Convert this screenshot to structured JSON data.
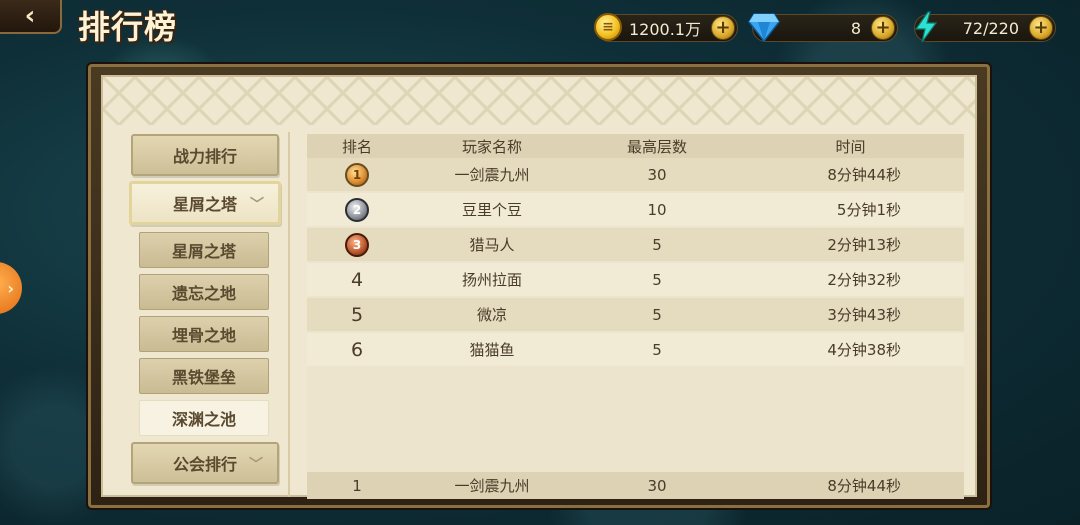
{
  "header": {
    "back_glyph": "‹",
    "title": "排行榜"
  },
  "resources": {
    "gold": {
      "value": "1200.1万",
      "icon": "gold-coin-icon"
    },
    "diamond": {
      "value": "8",
      "icon": "diamond-icon"
    },
    "energy": {
      "value": "72/220",
      "icon": "lightning-icon"
    },
    "plus_glyph": "+"
  },
  "sidebar": {
    "power_rank": "战力排行",
    "star_tower": "星屑之塔",
    "sub_items": [
      "星屑之塔",
      "遗忘之地",
      "埋骨之地",
      "黑铁堡垒",
      "深渊之池"
    ],
    "selected_sub": "深渊之池",
    "guild_rank": "公会排行",
    "chevron": "﹀"
  },
  "table": {
    "headers": {
      "rank": "排名",
      "name": "玩家名称",
      "floor": "最高层数",
      "time": "时间"
    },
    "rows": [
      {
        "rank": "1",
        "name": "一剑震九州",
        "floor": "30",
        "time": "8分钟44秒",
        "medal": "gold"
      },
      {
        "rank": "2",
        "name": "豆里个豆",
        "floor": "10",
        "time": "5分钟1秒",
        "medal": "silver"
      },
      {
        "rank": "3",
        "name": "猎马人",
        "floor": "5",
        "time": "2分钟13秒",
        "medal": "bronze"
      },
      {
        "rank": "4",
        "name": "扬州拉面",
        "floor": "5",
        "time": "2分钟32秒"
      },
      {
        "rank": "5",
        "name": "微凉",
        "floor": "5",
        "time": "3分钟43秒"
      },
      {
        "rank": "6",
        "name": "猫猫鱼",
        "floor": "5",
        "time": "4分钟38秒"
      }
    ],
    "my_rank": {
      "rank": "1",
      "name": "一剑震九州",
      "floor": "30",
      "time": "8分钟44秒"
    }
  },
  "edge_tab_glyph": "›",
  "colors": {
    "background": "#0f2f38",
    "panel": "#efe7cf",
    "accent_orange": "#e26a10"
  }
}
